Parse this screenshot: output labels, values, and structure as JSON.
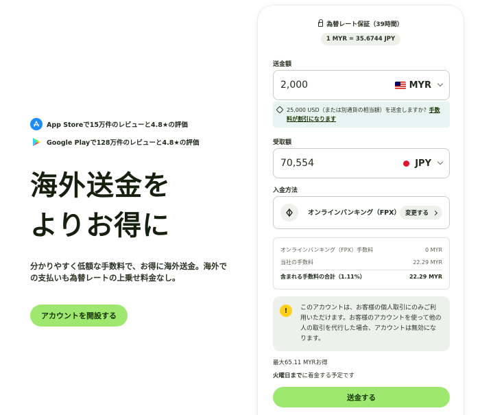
{
  "hero": {
    "appstore_text": "App Storeで15万件のレビューと4.8★の評価",
    "googleplay_text": "Google Playで128万件のレビューと4.8★の評価",
    "headline_line1": "海外送金を",
    "headline_line2": "よりお得に",
    "subtext": "分かりやすく低額な手数料で、お得に海外送金。海外での支払いも為替レートの上乗せ料金なし。",
    "cta_label": "アカウントを開設する"
  },
  "card": {
    "guarantee": "為替レート保証（39時間）",
    "rate": "1 MYR = 35.6744 JPY",
    "send_label": "送金額",
    "send_amount": "2,000",
    "send_currency": "MYR",
    "info_text": "25,000 USD（または別通貨の相当額）を送金しますか？",
    "info_link": "手数料が割引になります",
    "receive_label": "受取額",
    "receive_amount": "70,554",
    "receive_currency": "JPY",
    "method_label": "入金方法",
    "method_name": "オンラインバンキング（FPX）",
    "change_label": "変更する",
    "fees": [
      {
        "name": "オンラインバンキング（FPX）手数料",
        "value": "0 MYR"
      },
      {
        "name": "当社の手数料",
        "value": "22.29 MYR"
      }
    ],
    "fee_total_name": "含まれる手数料の合計（1.11%）",
    "fee_total_value": "22.29 MYR",
    "warning": "このアカウントは、お客様の個人取引にのみご利用いただけます。お客様のアカウントを使って他の人の取引を代行した場合、アカウントは無効になります。",
    "save_text": "最大65.11 MYRお得",
    "arrive_day": "火曜日まで",
    "arrive_rest": "に着金する予定です",
    "send_button": "送金する"
  },
  "colors": {
    "accent_green": "#9fe870",
    "warning_yellow": "#ffd11a",
    "info_bg": "#e8f4f1"
  }
}
